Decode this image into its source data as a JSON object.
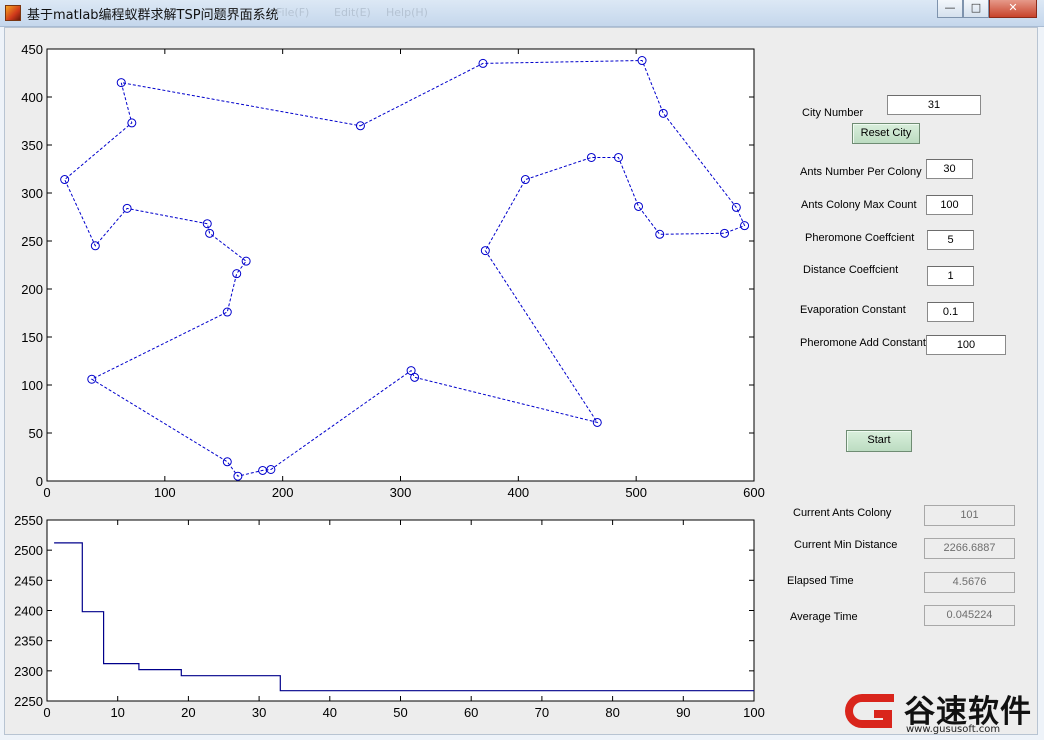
{
  "window": {
    "title": "基于matlab编程蚁群求解TSP问题界面系统",
    "ghost_menu": [
      "File(F)",
      "Edit(E)",
      "Help(H)"
    ]
  },
  "controls": {
    "city_number_label": "City Number",
    "city_number_value": "31",
    "reset_city_button": "Reset City",
    "ants_per_colony_label": "Ants Number Per Colony",
    "ants_per_colony_value": "30",
    "max_count_label": "Ants Colony Max Count",
    "max_count_value": "100",
    "pheromone_coef_label": "Pheromone Coeffcient",
    "pheromone_coef_value": "5",
    "distance_coef_label": "Distance Coeffcient",
    "distance_coef_value": "1",
    "evaporation_label": "Evaporation Constant",
    "evaporation_value": "0.1",
    "pheromone_add_label": "Pheromone Add Constant",
    "pheromone_add_value": "100",
    "start_button": "Start"
  },
  "status": {
    "current_colony_label": "Current Ants Colony",
    "current_colony_value": "101",
    "min_distance_label": "Current Min Distance",
    "min_distance_value": "2266.6887",
    "elapsed_label": "Elapsed Time",
    "elapsed_value": "4.5676",
    "average_label": "Average Time",
    "average_value": "0.045224"
  },
  "watermark": {
    "text": "谷速软件",
    "url": "www.gususoft.com"
  },
  "colors": {
    "route": "#0000cc",
    "convergence": "#00008b",
    "axes_bg": "#ffffff",
    "figure_bg": "#ededed",
    "button_bg": "#c8e6cc",
    "watermark_red": "#d9251c"
  },
  "chart_data": [
    {
      "type": "scatter",
      "title": "",
      "xlabel": "",
      "ylabel": "",
      "xlim": [
        0,
        600
      ],
      "ylim": [
        0,
        450
      ],
      "xticks": [
        0,
        100,
        200,
        300,
        400,
        500,
        600
      ],
      "yticks": [
        0,
        50,
        100,
        150,
        200,
        250,
        300,
        350,
        400,
        450
      ],
      "grid": false,
      "line_style": "dashed",
      "marker": "circle",
      "closed_route": true,
      "route": [
        [
          266,
          370
        ],
        [
          370,
          435
        ],
        [
          505,
          438
        ],
        [
          523,
          383
        ],
        [
          585,
          285
        ],
        [
          592,
          266
        ],
        [
          575,
          258
        ],
        [
          520,
          257
        ],
        [
          502,
          286
        ],
        [
          485,
          337
        ],
        [
          462,
          337
        ],
        [
          406,
          314
        ],
        [
          372,
          240
        ],
        [
          467,
          61
        ],
        [
          312,
          108
        ],
        [
          309,
          115
        ],
        [
          190,
          12
        ],
        [
          183,
          11
        ],
        [
          162,
          5
        ],
        [
          153,
          20
        ],
        [
          38,
          106
        ],
        [
          153,
          176
        ],
        [
          161,
          216
        ],
        [
          169,
          229
        ],
        [
          138,
          258
        ],
        [
          136,
          268
        ],
        [
          68,
          284
        ],
        [
          41,
          245
        ],
        [
          15,
          314
        ],
        [
          72,
          373
        ],
        [
          63,
          415
        ]
      ]
    },
    {
      "type": "line",
      "title": "",
      "xlabel": "",
      "ylabel": "",
      "xlim": [
        0,
        100
      ],
      "ylim": [
        2250,
        2550
      ],
      "xticks": [
        0,
        10,
        20,
        30,
        40,
        50,
        60,
        70,
        80,
        90,
        100
      ],
      "yticks": [
        2250,
        2300,
        2350,
        2400,
        2450,
        2500,
        2550
      ],
      "grid": false,
      "step": true,
      "points": [
        [
          1,
          2512
        ],
        [
          4,
          2512
        ],
        [
          5,
          2398
        ],
        [
          7,
          2398
        ],
        [
          8,
          2312
        ],
        [
          12,
          2312
        ],
        [
          13,
          2302
        ],
        [
          18,
          2302
        ],
        [
          19,
          2292
        ],
        [
          32,
          2292
        ],
        [
          33,
          2267
        ],
        [
          100,
          2267
        ]
      ]
    }
  ]
}
